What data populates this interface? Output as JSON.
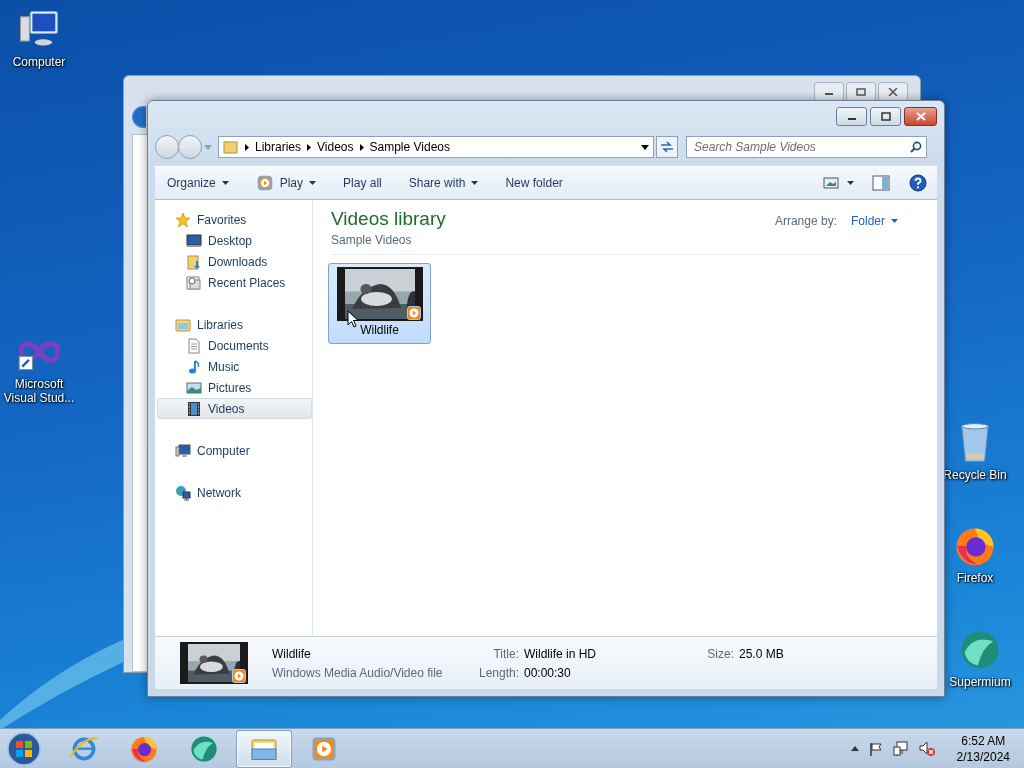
{
  "desktop_icons": [
    {
      "label": "Computer",
      "kind": "computer"
    },
    {
      "label": "Microsoft Visual Stud...",
      "kind": "vs"
    },
    {
      "label": "Recycle Bin",
      "kind": "bin"
    },
    {
      "label": "Firefox",
      "kind": "firefox"
    },
    {
      "label": "Supermium",
      "kind": "supermium"
    }
  ],
  "window": {
    "breadcrumb": [
      "Libraries",
      "Videos",
      "Sample Videos"
    ],
    "search": {
      "placeholder": "Search Sample Videos"
    },
    "toolbar": [
      {
        "label": "Organize",
        "kind": "menu"
      },
      {
        "label": "Play",
        "kind": "play"
      },
      {
        "label": "Play all",
        "kind": "plain"
      },
      {
        "label": "Share with",
        "kind": "menu"
      },
      {
        "label": "New folder",
        "kind": "plain"
      }
    ],
    "sidebar": [
      {
        "label": "Favorites",
        "selected": false,
        "children": [
          {
            "label": "Desktop",
            "selected": false
          },
          {
            "label": "Downloads",
            "selected": false
          },
          {
            "label": "Recent Places",
            "selected": false
          }
        ]
      },
      {
        "label": "Libraries",
        "selected": false,
        "children": [
          {
            "label": "Documents",
            "selected": false
          },
          {
            "label": "Music",
            "selected": false
          },
          {
            "label": "Pictures",
            "selected": false
          },
          {
            "label": "Videos",
            "selected": true
          }
        ]
      },
      {
        "label": "Computer",
        "selected": false
      },
      {
        "label": "Network",
        "selected": false
      }
    ],
    "library": {
      "title": "Videos library",
      "subtitle": "Sample Videos",
      "arrange_label": "Arrange by:",
      "arrange_value": "Folder"
    },
    "files": [
      {
        "name": "Wildlife",
        "selected": true
      }
    ],
    "details": {
      "name": "Wildlife",
      "type": "Windows Media Audio/Video file",
      "properties": [
        {
          "label": "Title:",
          "value": "Wildlife in HD"
        },
        {
          "label": "Length:",
          "value": "00:00:30"
        },
        {
          "label": "Size:",
          "value": "25.0 MB"
        }
      ]
    }
  },
  "taskbar": {
    "apps": [
      {
        "kind": "ie",
        "selected": false
      },
      {
        "kind": "firefox",
        "selected": false
      },
      {
        "kind": "supermium",
        "selected": false
      },
      {
        "kind": "explorer",
        "selected": true
      },
      {
        "kind": "wmp",
        "selected": false
      }
    ],
    "clock": {
      "time": "6:52 AM",
      "date": "2/13/2024"
    }
  }
}
